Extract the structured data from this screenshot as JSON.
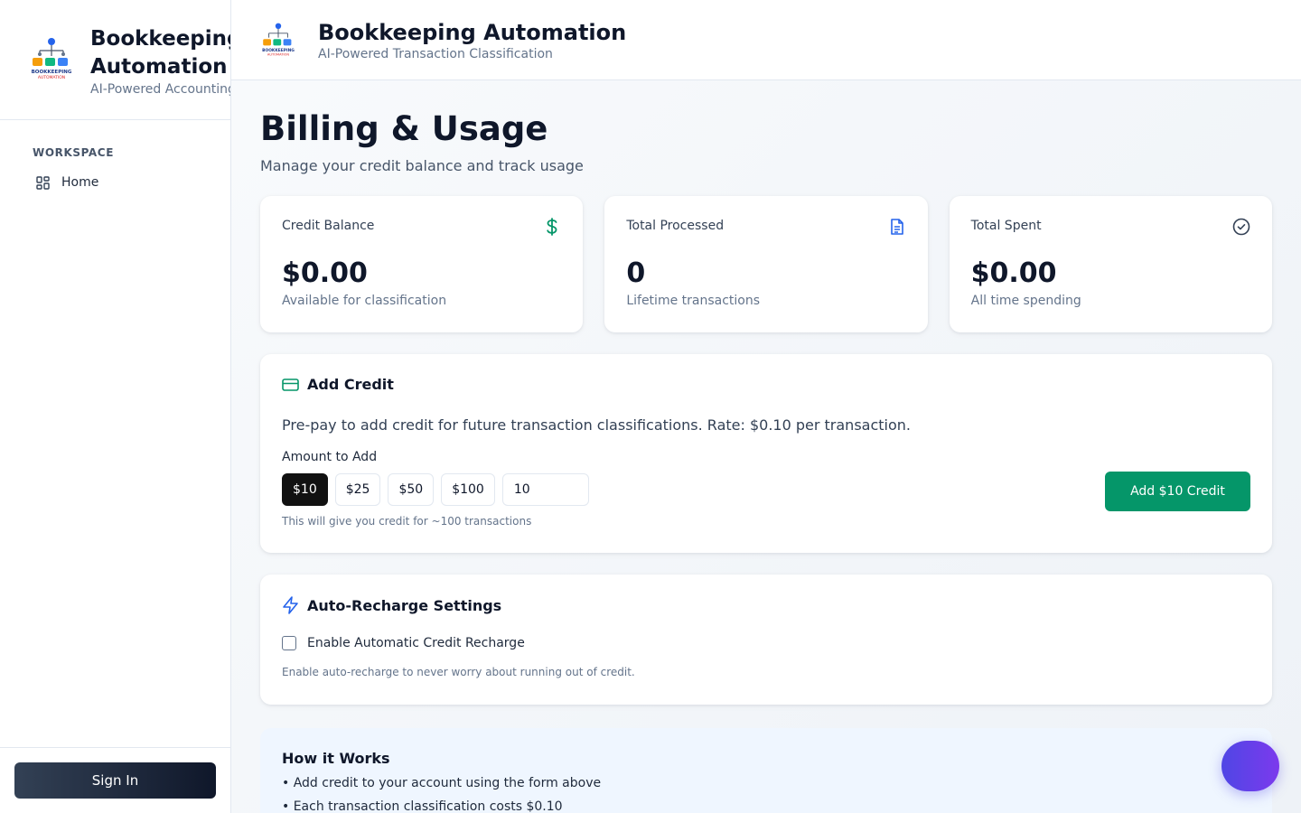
{
  "app": {
    "title": "Bookkeeping Automation",
    "sidebar_subtitle": "AI-Powered Accounting",
    "top_subtitle": "AI-Powered Transaction Classification",
    "logo_text": "BOOKKEEPING AUTOMATION"
  },
  "sidebar": {
    "section_label": "WORKSPACE",
    "items": [
      {
        "label": "Home",
        "icon": "grid-icon"
      }
    ],
    "signin_label": "Sign In"
  },
  "page": {
    "title": "Billing & Usage",
    "subtitle": "Manage your credit balance and track usage"
  },
  "stats": [
    {
      "label": "Credit Balance",
      "value": "$0.00",
      "note": "Available for classification",
      "icon": "dollar-icon",
      "color": "#059669"
    },
    {
      "label": "Total Processed",
      "value": "0",
      "note": "Lifetime transactions",
      "icon": "document-icon",
      "color": "#2563eb"
    },
    {
      "label": "Total Spent",
      "value": "$0.00",
      "note": "All time spending",
      "icon": "check-circle-icon",
      "color": "#334155"
    }
  ],
  "add_credit": {
    "title": "Add Credit",
    "description": "Pre-pay to add credit for future transaction classifications. Rate: $0.10 per transaction.",
    "amount_label": "Amount to Add",
    "amounts": [
      "$10",
      "$25",
      "$50",
      "$100"
    ],
    "selected": "$10",
    "custom_value": "10",
    "hint": "This will give you credit for ~100 transactions",
    "button_label": "Add $10 Credit"
  },
  "auto_recharge": {
    "title": "Auto-Recharge Settings",
    "checkbox_label": "Enable Automatic Credit Recharge",
    "checked": false,
    "note": "Enable auto-recharge to never worry about running out of credit."
  },
  "how_it_works": {
    "title": "How it Works",
    "items": [
      "• Add credit to your account using the form above",
      "• Each transaction classification costs $0.10"
    ]
  },
  "colors": {
    "accent_green": "#059669",
    "accent_blue": "#2563eb",
    "dark": "#0f172a",
    "fab_gradient_start": "#4f46e5",
    "fab_gradient_end": "#7c3aed"
  }
}
